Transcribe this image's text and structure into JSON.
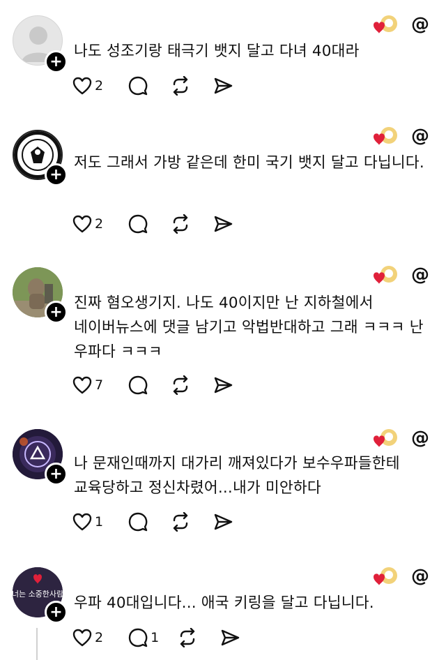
{
  "posts": [
    {
      "text": "나도 성조기랑 태극기 뱃지 달고 다녀 40대라",
      "likes": "2",
      "replies": ""
    },
    {
      "text": "저도 그래서 가방 같은데 한미 국기 뱃지 달고 다닙니다.",
      "likes": "2",
      "replies": ""
    },
    {
      "text": "진짜 혐오생기지. 나도 40이지만 난 지하철에서 네이버뉴스에 댓글 남기고 악법반대하고 그래 ㅋㅋㅋ 난 우파다 ㅋㅋㅋ",
      "likes": "7",
      "replies": ""
    },
    {
      "text": "나 문재인때까지 대가리 깨져있다가 보수우파들한테 교육당하고 정신차렸어...내가 미안하다",
      "likes": "1",
      "replies": ""
    },
    {
      "text": "우파 40대입니다... 애국 키링을 달고 다닙니다.",
      "likes": "2",
      "replies": "1",
      "avatar_text": "너는 소중한사람"
    }
  ],
  "icons": {
    "follow": "+",
    "threads": "@",
    "like": "heart-icon",
    "reply": "comment-icon",
    "repost": "repost-icon",
    "share": "send-icon"
  },
  "colors": {
    "heart": "#e0203a",
    "divider": "#e3e3e3"
  }
}
